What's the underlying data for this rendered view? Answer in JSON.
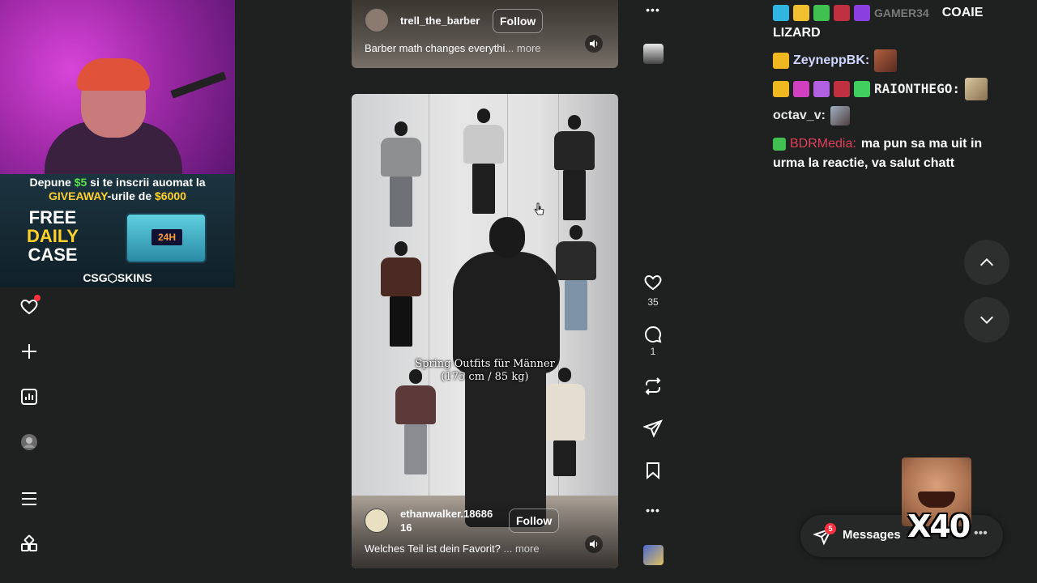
{
  "promo": {
    "line1_a": "Depune ",
    "line1_amount": "$5",
    "line1_b": " si te inscrii auomat la",
    "line2_a": "GIVEAWAY",
    "line2_b": "-urile de ",
    "line2_amount": "$6000",
    "free_word": "FREE",
    "daily_word": "DAILY",
    "case_word": "CASE",
    "case_timer": "24H",
    "brand": "CSG⬡SKINS"
  },
  "nav": {
    "items": [
      "heart-icon",
      "plus-icon",
      "insights-icon",
      "profile-icon",
      "menu-icon",
      "apps-icon"
    ]
  },
  "post_top": {
    "username": "trell_the_barber",
    "follow_label": "Follow",
    "description": "Barber math changes everythi",
    "more_label": "... more"
  },
  "post_main": {
    "caption_line1": "Spring Outfits für Männer",
    "caption_line2": "(175 cm / 85 kg)",
    "username_line1": "ethanwalker.18686",
    "username_line2": "16",
    "follow_label": "Follow",
    "description": "Welches Teil ist dein Favorit?",
    "more_label": "... more"
  },
  "actions": {
    "more_top": "•••",
    "like_count": "35",
    "comment_count": "1",
    "more_bottom": "•••"
  },
  "chat": {
    "line1_user": "GAMER34",
    "line1_text": "COAIE",
    "line1_cont": "LIZARD",
    "line2_user": "ZeyneppBK:",
    "line3_user": "RAIONTHEGO:",
    "line4_user": "octav_v:",
    "line5_user": "BDRMedia:",
    "line5_text": "ma pun sa ma uit in",
    "line5_cont": "urma la reactie, va salut chatt",
    "colors": {
      "bdr": "#e0405a",
      "text": "#ffffff"
    }
  },
  "messages": {
    "badge_count": "5",
    "label": "Messages",
    "combo": "X40"
  }
}
